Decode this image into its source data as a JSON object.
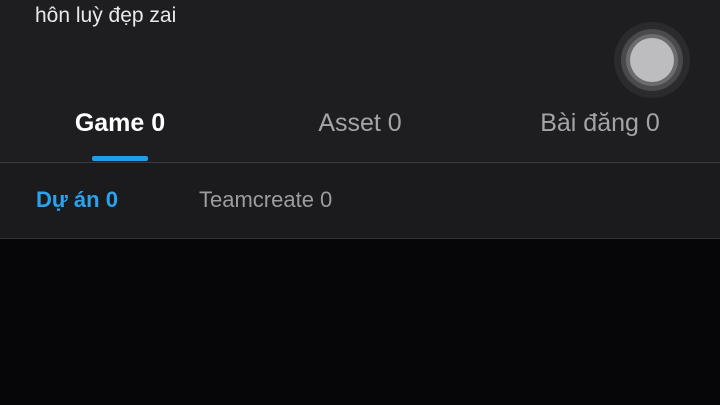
{
  "profile": {
    "bio": "hôn luỳ đẹp zai"
  },
  "tabs": [
    {
      "label": "Game 0",
      "selected": true
    },
    {
      "label": "Asset 0",
      "selected": false
    },
    {
      "label": "Bài đăng 0",
      "selected": false
    }
  ],
  "subtabs": [
    {
      "label": "Dự án 0",
      "selected": true
    },
    {
      "label": "Teamcreate 0",
      "selected": false
    }
  ],
  "colors": {
    "accent": "#1f9de6",
    "panel": "#1e1e21",
    "background": "#060609",
    "text_primary": "#ffffff",
    "text_secondary": "#a4a4a8"
  },
  "icons": {
    "floating_button": "assistive-touch-icon"
  }
}
